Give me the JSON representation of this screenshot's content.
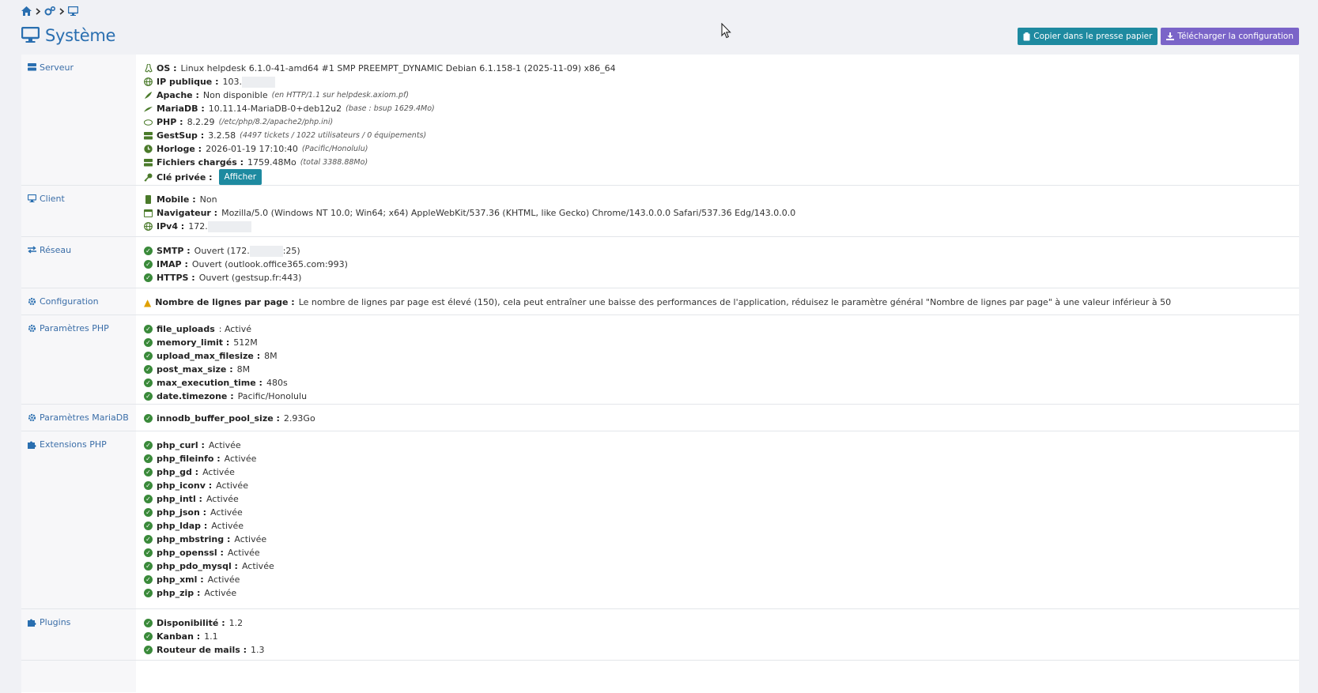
{
  "page": {
    "title": "Système",
    "copy_button": "Copier dans le presse papier",
    "download_button": "Télécharger la configuration"
  },
  "rows": [
    {
      "category": "Serveur",
      "lines": [
        {
          "icon": "linux-icon",
          "label": "OS :",
          "value": "Linux helpdesk 6.1.0-41-amd64 #1 SMP PREEMPT_DYNAMIC Debian 6.1.158-1 (2025-11-09) x86_64"
        },
        {
          "icon": "globe-icon",
          "label": "IP publique :",
          "value": "103."
        },
        {
          "icon": "feather-icon",
          "label": "Apache :",
          "value": "Non disponible",
          "sub": "(en HTTP/1.1 sur helpdesk.axiom.pf)"
        },
        {
          "icon": "dolphin-icon",
          "label": "MariaDB :",
          "value": "10.11.14-MariaDB-0+deb12u2",
          "sub": "(base : bsup 1629.4Mo)"
        },
        {
          "icon": "php-icon",
          "label": "PHP :",
          "value": "8.2.29",
          "sub": "(/etc/php/8.2/apache2/php.ini)"
        },
        {
          "icon": "server-icon",
          "label": "GestSup :",
          "value": "3.2.58",
          "sub": "(4497 tickets / 1022 utilisateurs / 0 équipements)"
        },
        {
          "icon": "clock-icon",
          "label": "Horloge :",
          "value": "2026-01-19 17:10:40",
          "sub": "(Pacific/Honolulu)"
        },
        {
          "icon": "hdd-icon",
          "label": "Fichiers chargés :",
          "value": "1759.48Mo",
          "sub": "(total 3388.88Mo)"
        },
        {
          "icon": "key-icon",
          "label": "Clé privée :",
          "value": "",
          "button": "Afficher"
        }
      ]
    },
    {
      "category": "Client",
      "lines": [
        {
          "icon": "mobile-icon",
          "label": "Mobile :",
          "value": "Non"
        },
        {
          "icon": "browser-icon",
          "label": "Navigateur :",
          "value": "Mozilla/5.0 (Windows NT 10.0; Win64; x64) AppleWebKit/537.36 (KHTML, like Gecko) Chrome/143.0.0.0 Safari/537.36 Edg/143.0.0.0"
        },
        {
          "icon": "globe-icon",
          "label": "IPv4 :",
          "value": "172."
        }
      ]
    },
    {
      "category": "Réseau",
      "lines": [
        {
          "icon": "check-icon",
          "label": "SMTP :",
          "value": "Ouvert (172.",
          "value2": ":25)"
        },
        {
          "icon": "check-icon",
          "label": "IMAP :",
          "value": "Ouvert (outlook.office365.com:993)"
        },
        {
          "icon": "check-icon",
          "label": "HTTPS :",
          "value": "Ouvert (gestsup.fr:443)"
        }
      ]
    },
    {
      "category": "Configuration",
      "lines": [
        {
          "icon": "warning-icon",
          "label": "Nombre de lignes par page :",
          "value": "Le nombre de lignes par page est élevé (150), cela peut entraîner une baisse des performances de l'application, réduisez le paramètre général \"Nombre de lignes par page\" à une valeur inférieur à 50"
        }
      ]
    },
    {
      "category": "Paramètres PHP",
      "lines": [
        {
          "icon": "check-icon",
          "label": "file_uploads",
          "value": ": Activé"
        },
        {
          "icon": "check-icon",
          "label": "memory_limit :",
          "value": "512M"
        },
        {
          "icon": "check-icon",
          "label": "upload_max_filesize :",
          "value": "8M"
        },
        {
          "icon": "check-icon",
          "label": "post_max_size :",
          "value": "8M"
        },
        {
          "icon": "check-icon",
          "label": "max_execution_time :",
          "value": "480s"
        },
        {
          "icon": "check-icon",
          "label": "date.timezone :",
          "value": "Pacific/Honolulu"
        }
      ]
    },
    {
      "category": "Paramètres MariaDB",
      "lines": [
        {
          "icon": "check-icon",
          "label": "innodb_buffer_pool_size :",
          "value": "2.93Go"
        }
      ]
    },
    {
      "category": "Extensions PHP",
      "lines": [
        {
          "icon": "check-icon",
          "label": "php_curl :",
          "value": "Activée"
        },
        {
          "icon": "check-icon",
          "label": "php_fileinfo :",
          "value": "Activée"
        },
        {
          "icon": "check-icon",
          "label": "php_gd :",
          "value": "Activée"
        },
        {
          "icon": "check-icon",
          "label": "php_iconv :",
          "value": "Activée"
        },
        {
          "icon": "check-icon",
          "label": "php_intl :",
          "value": "Activée"
        },
        {
          "icon": "check-icon",
          "label": "php_json :",
          "value": "Activée"
        },
        {
          "icon": "check-icon",
          "label": "php_ldap :",
          "value": "Activée"
        },
        {
          "icon": "check-icon",
          "label": "php_mbstring :",
          "value": "Activée"
        },
        {
          "icon": "check-icon",
          "label": "php_openssl :",
          "value": "Activée"
        },
        {
          "icon": "check-icon",
          "label": "php_pdo_mysql :",
          "value": "Activée"
        },
        {
          "icon": "check-icon",
          "label": "php_xml :",
          "value": "Activée"
        },
        {
          "icon": "check-icon",
          "label": "php_zip :",
          "value": "Activée"
        }
      ]
    },
    {
      "category": "Plugins",
      "lines": [
        {
          "icon": "check-icon",
          "label": "Disponibilité :",
          "value": "1.2"
        },
        {
          "icon": "check-icon",
          "label": "Kanban :",
          "value": "1.1"
        },
        {
          "icon": "check-icon",
          "label": "Routeur de mails :",
          "value": "1.3"
        }
      ]
    }
  ],
  "colors": {
    "accent": "#2a6fb0",
    "teal": "#1e8aa0",
    "purple": "#7a64c8",
    "ok": "#3a8a3a",
    "warning": "#e0a000"
  }
}
